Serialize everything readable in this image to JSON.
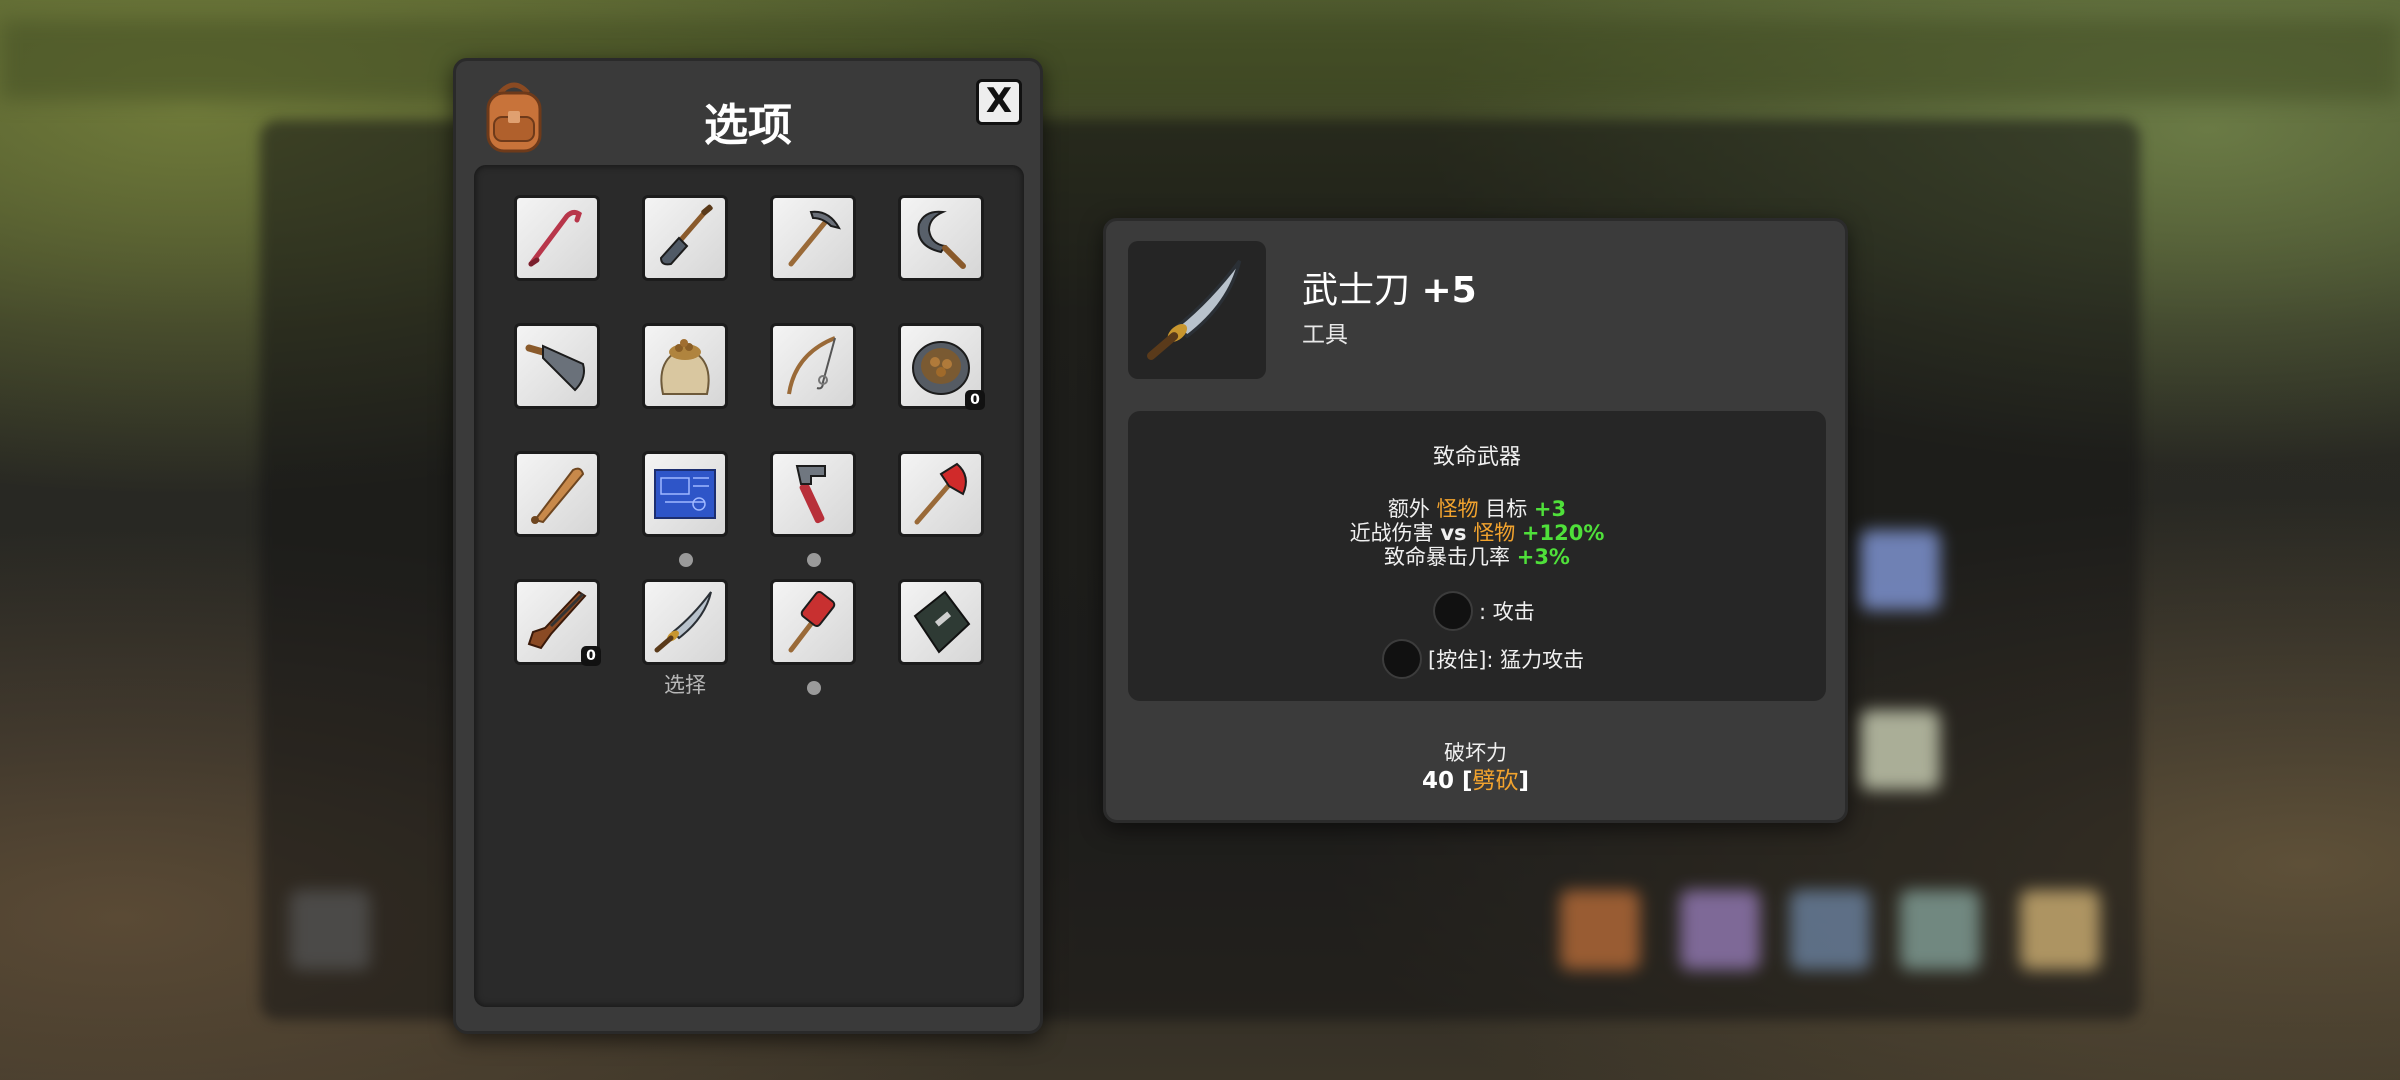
{
  "inventory": {
    "title": "选项",
    "close_label": "X",
    "slots": [
      {
        "icon": "crowbar-icon"
      },
      {
        "icon": "shovel-icon"
      },
      {
        "icon": "pickaxe-icon"
      },
      {
        "icon": "sickle-icon"
      },
      {
        "icon": "machete-icon"
      },
      {
        "icon": "seed-sack-icon"
      },
      {
        "icon": "fishing-rod-icon"
      },
      {
        "icon": "food-bowl-icon",
        "count": "0"
      },
      {
        "icon": "baseball-bat-icon"
      },
      {
        "icon": "blueprint-icon"
      },
      {
        "icon": "pipe-wrench-icon"
      },
      {
        "icon": "fire-axe-icon"
      },
      {
        "icon": "rifle-icon",
        "count": "0"
      },
      {
        "icon": "katana-icon",
        "label": "选择"
      },
      {
        "icon": "sledgehammer-icon"
      },
      {
        "icon": "riot-shield-icon"
      }
    ]
  },
  "detail": {
    "icon": "katana-icon",
    "name": "武士刀",
    "level": "+5",
    "type": "工具",
    "category": "致命武器",
    "stats": {
      "line1": {
        "pre": "额外 ",
        "hl": "怪物",
        "post": " 目标 ",
        "val": "+3"
      },
      "line2": {
        "pre": "近战伤害 ",
        "vs": "vs",
        "hl": "怪物",
        "val": "+120%"
      },
      "line3": {
        "pre": "致命暴击几率 ",
        "val": "+3%"
      }
    },
    "controls": {
      "attack": ": 攻击",
      "hold_prefix": "[按住]",
      "heavy": ": 猛力攻击"
    },
    "damage_label": "破坏力",
    "damage_value": "40",
    "damage_type_open": "[",
    "damage_type": "劈砍",
    "damage_type_close": "]"
  },
  "colors": {
    "highlight": "#f2a32e",
    "bonus": "#4fe03a",
    "panel": "#3a3a3a"
  }
}
